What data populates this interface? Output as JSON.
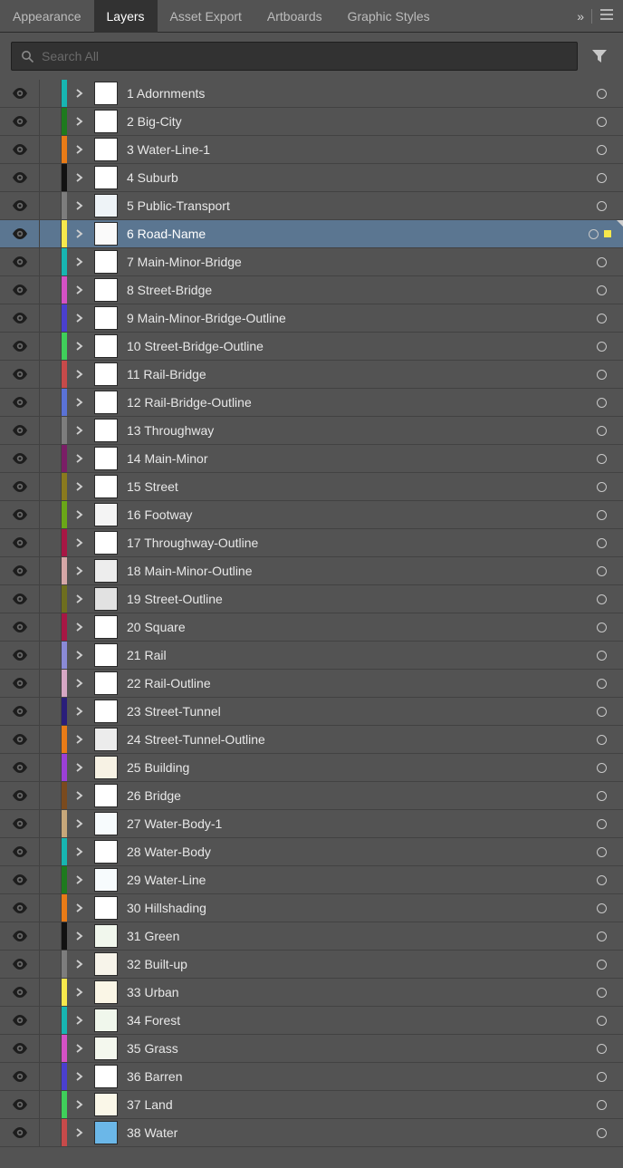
{
  "tabs": {
    "items": [
      {
        "label": "Appearance",
        "active": false
      },
      {
        "label": "Layers",
        "active": true
      },
      {
        "label": "Asset Export",
        "active": false
      },
      {
        "label": "Artboards",
        "active": false
      },
      {
        "label": "Graphic Styles",
        "active": false
      }
    ]
  },
  "search": {
    "placeholder": "Search All"
  },
  "layers": [
    {
      "index": 1,
      "name": "Adornments",
      "color": "#17b5b1",
      "thumb": "#ffffff",
      "selected": false
    },
    {
      "index": 2,
      "name": "Big-City",
      "color": "#1e7a1e",
      "thumb": "#ffffff",
      "selected": false
    },
    {
      "index": 3,
      "name": "Water-Line-1",
      "color": "#e87b17",
      "thumb": "#ffffff",
      "selected": false
    },
    {
      "index": 4,
      "name": "Suburb",
      "color": "#111111",
      "thumb": "#ffffff",
      "selected": false
    },
    {
      "index": 5,
      "name": "Public-Transport",
      "color": "#7d7d7d",
      "thumb": "#eef3f7",
      "selected": false
    },
    {
      "index": 6,
      "name": "Road-Name",
      "color": "#f7e84c",
      "thumb": "#fafafa",
      "selected": true
    },
    {
      "index": 7,
      "name": "Main-Minor-Bridge",
      "color": "#17b5b1",
      "thumb": "#ffffff",
      "selected": false
    },
    {
      "index": 8,
      "name": "Street-Bridge",
      "color": "#d451c4",
      "thumb": "#ffffff",
      "selected": false
    },
    {
      "index": 9,
      "name": "Main-Minor-Bridge-Outline",
      "color": "#4a3fcf",
      "thumb": "#ffffff",
      "selected": false
    },
    {
      "index": 10,
      "name": "Street-Bridge-Outline",
      "color": "#3fcf5a",
      "thumb": "#ffffff",
      "selected": false
    },
    {
      "index": 11,
      "name": "Rail-Bridge",
      "color": "#c74a4a",
      "thumb": "#ffffff",
      "selected": false
    },
    {
      "index": 12,
      "name": "Rail-Bridge-Outline",
      "color": "#5a72d6",
      "thumb": "#ffffff",
      "selected": false
    },
    {
      "index": 13,
      "name": "Throughway",
      "color": "#7d7d7d",
      "thumb": "#ffffff",
      "selected": false
    },
    {
      "index": 14,
      "name": "Main-Minor",
      "color": "#7a1e66",
      "thumb": "#ffffff",
      "selected": false
    },
    {
      "index": 15,
      "name": "Street",
      "color": "#8a7a1e",
      "thumb": "#ffffff",
      "selected": false
    },
    {
      "index": 16,
      "name": "Footway",
      "color": "#6aa717",
      "thumb": "#f4f4f4",
      "selected": false
    },
    {
      "index": 17,
      "name": "Throughway-Outline",
      "color": "#a71744",
      "thumb": "#ffffff",
      "selected": false
    },
    {
      "index": 18,
      "name": "Main-Minor-Outline",
      "color": "#d6a7a7",
      "thumb": "#ededed",
      "selected": false
    },
    {
      "index": 19,
      "name": "Street-Outline",
      "color": "#6e6e1e",
      "thumb": "#e2e2e2",
      "selected": false
    },
    {
      "index": 20,
      "name": "Square",
      "color": "#a71744",
      "thumb": "#ffffff",
      "selected": false
    },
    {
      "index": 21,
      "name": "Rail",
      "color": "#8a8ad6",
      "thumb": "#ffffff",
      "selected": false
    },
    {
      "index": 22,
      "name": "Rail-Outline",
      "color": "#d6a7c4",
      "thumb": "#ffffff",
      "selected": false
    },
    {
      "index": 23,
      "name": "Street-Tunnel",
      "color": "#2a1e7a",
      "thumb": "#ffffff",
      "selected": false
    },
    {
      "index": 24,
      "name": "Street-Tunnel-Outline",
      "color": "#e87b17",
      "thumb": "#ececec",
      "selected": false
    },
    {
      "index": 25,
      "name": "Building",
      "color": "#9b3fd6",
      "thumb": "#f7f2e4",
      "selected": false
    },
    {
      "index": 26,
      "name": "Bridge",
      "color": "#7a4a1e",
      "thumb": "#ffffff",
      "selected": false
    },
    {
      "index": 27,
      "name": "Water-Body-1",
      "color": "#c7a77a",
      "thumb": "#f7fbfd",
      "selected": false
    },
    {
      "index": 28,
      "name": "Water-Body",
      "color": "#17b5b1",
      "thumb": "#ffffff",
      "selected": false
    },
    {
      "index": 29,
      "name": "Water-Line",
      "color": "#1e7a1e",
      "thumb": "#f7fbfd",
      "selected": false
    },
    {
      "index": 30,
      "name": "Hillshading",
      "color": "#e87b17",
      "thumb": "#ffffff",
      "selected": false
    },
    {
      "index": 31,
      "name": "Green",
      "color": "#111111",
      "thumb": "#f1f7ed",
      "selected": false
    },
    {
      "index": 32,
      "name": "Built-up",
      "color": "#7d7d7d",
      "thumb": "#f7f4ea",
      "selected": false
    },
    {
      "index": 33,
      "name": "Urban",
      "color": "#f7e84c",
      "thumb": "#faf6e6",
      "selected": false
    },
    {
      "index": 34,
      "name": "Forest",
      "color": "#17b5b1",
      "thumb": "#f0f7ec",
      "selected": false
    },
    {
      "index": 35,
      "name": "Grass",
      "color": "#d451c4",
      "thumb": "#f4f8ee",
      "selected": false
    },
    {
      "index": 36,
      "name": "Barren",
      "color": "#4a3fcf",
      "thumb": "#ffffff",
      "selected": false
    },
    {
      "index": 37,
      "name": "Land",
      "color": "#3fcf5a",
      "thumb": "#faf7e8",
      "selected": false
    },
    {
      "index": 38,
      "name": "Water",
      "color": "#c74a4a",
      "thumb": "#6bb7e8",
      "selected": false
    }
  ]
}
